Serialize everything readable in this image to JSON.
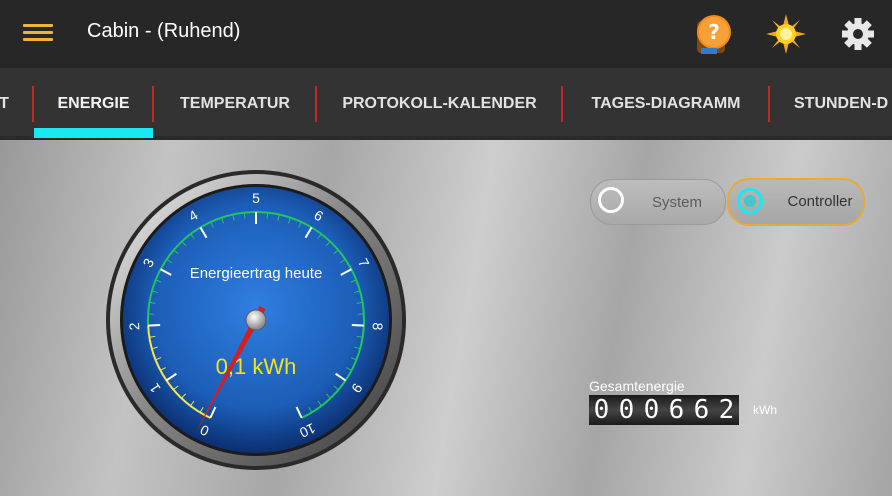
{
  "app": {
    "title": "Cabin - (Ruhend)"
  },
  "toolbar": {
    "menu_icon": "hamburger-menu-icon",
    "help_icon": "help-book-icon",
    "sun_icon": "sun-icon",
    "settings_icon": "gear-icon"
  },
  "tabs": [
    {
      "label": "T"
    },
    {
      "label": "ENERGIE",
      "selected": true
    },
    {
      "label": "TEMPERATUR"
    },
    {
      "label": "PROTOKOLL-KALENDER"
    },
    {
      "label": "TAGES-DIAGRAMM"
    },
    {
      "label": "STUNDEN-D"
    }
  ],
  "source_toggle": {
    "system_label": "System",
    "controller_label": "Controller",
    "selected": "Controller"
  },
  "gauge": {
    "title": "Energieertrag heute",
    "value_text": "0,1 kWh",
    "value": 0.1,
    "min": 0,
    "max": 10,
    "tick_labels": [
      "0",
      "1",
      "2",
      "3",
      "4",
      "5",
      "6",
      "7",
      "8",
      "9",
      "10"
    ]
  },
  "counter": {
    "label": "Gesamtenergie",
    "digits": [
      "0",
      "0",
      "0",
      "6",
      "6",
      "2"
    ],
    "unit": "kWh"
  },
  "colors": {
    "accent": "#f0b43a",
    "tab_indicator": "#18e9f2",
    "tab_separator": "#c62828",
    "gauge_face": "#1f6bc8",
    "gauge_scale": "#22c55e",
    "gauge_low_zone": "#f2e84a",
    "needle": "#d41f1f",
    "value_text": "#f4e21a"
  }
}
